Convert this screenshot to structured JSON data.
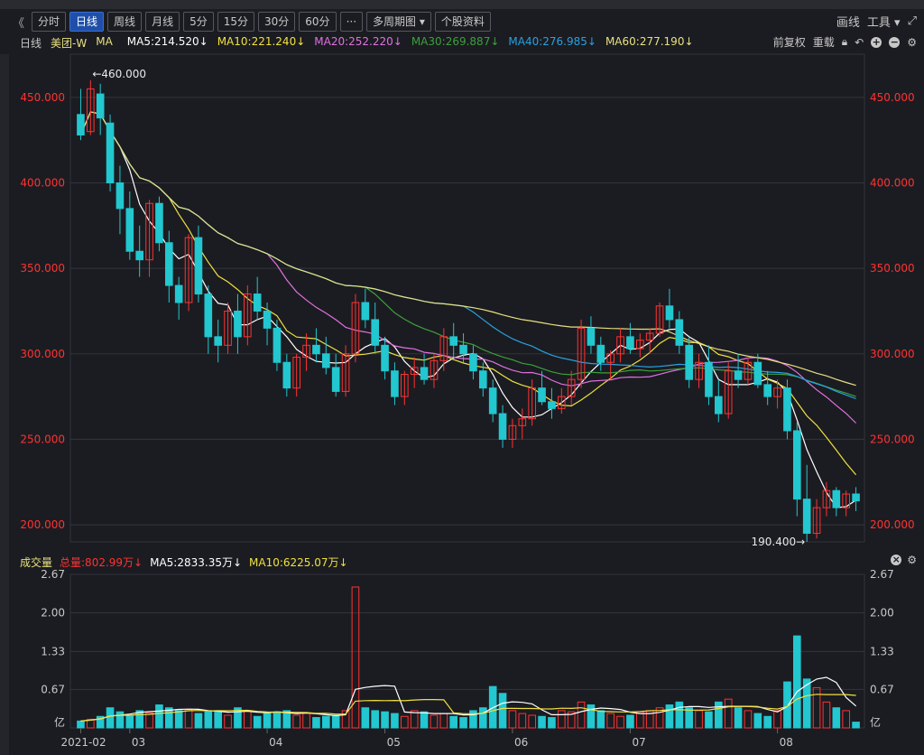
{
  "toolbar": {
    "nav_prev": "《",
    "buttons": [
      "分时",
      "日线",
      "周线",
      "月线",
      "5分",
      "15分",
      "30分",
      "60分",
      "···",
      "多周期图 ▾",
      "个股资料"
    ],
    "active_index": 1,
    "draw_label": "画线",
    "tools_label": "工具 ▾",
    "expand_icon": "expand-icon"
  },
  "ma_legend": {
    "period": "日线",
    "name": "美团-W",
    "ma": "MA",
    "items": [
      {
        "label": "MA5:214.520↓",
        "color": "#ffffff"
      },
      {
        "label": "MA10:221.240↓",
        "color": "#f0e040"
      },
      {
        "label": "MA20:252.220↓",
        "color": "#e070e0"
      },
      {
        "label": "MA30:269.887↓",
        "color": "#3ca03c"
      },
      {
        "label": "MA40:276.985↓",
        "color": "#2aa0e0"
      },
      {
        "label": "MA60:277.190↓",
        "color": "#e8e080"
      }
    ],
    "adjust": "前复权",
    "reload": "重载"
  },
  "price_axis": {
    "ticks": [
      "450.000",
      "400.000",
      "350.000",
      "300.000",
      "250.000",
      "200.000"
    ],
    "high_label": "←460.000",
    "low_label": "190.400→"
  },
  "volume_panel": {
    "title": "成交量",
    "total": "总量:802.99万↓",
    "ma5": "MA5:2833.35万↓",
    "ma10": "MA10:6225.07万↓",
    "ticks": [
      "2.67",
      "2.00",
      "1.33",
      "0.67",
      "亿"
    ]
  },
  "x_axis": {
    "labels": [
      "2021-02",
      "03",
      "04",
      "05",
      "06",
      "07",
      "08"
    ]
  },
  "colors": {
    "up": "#ff3232",
    "down": "#22c7d0",
    "bg": "#1b1c21",
    "grid": "#33353c"
  },
  "chart_data": {
    "type": "candlestick",
    "title": "",
    "ylim": [
      190,
      470
    ],
    "ohlc": [
      [
        440,
        455,
        425,
        428
      ],
      [
        430,
        460,
        428,
        455
      ],
      [
        452,
        458,
        428,
        438
      ],
      [
        435,
        440,
        395,
        400
      ],
      [
        400,
        410,
        370,
        385
      ],
      [
        385,
        395,
        355,
        360
      ],
      [
        360,
        375,
        345,
        355
      ],
      [
        355,
        390,
        345,
        388
      ],
      [
        388,
        392,
        360,
        365
      ],
      [
        365,
        372,
        330,
        340
      ],
      [
        340,
        345,
        320,
        330
      ],
      [
        330,
        370,
        325,
        368
      ],
      [
        368,
        375,
        330,
        335
      ],
      [
        335,
        340,
        300,
        310
      ],
      [
        310,
        320,
        295,
        305
      ],
      [
        305,
        330,
        300,
        325
      ],
      [
        325,
        335,
        300,
        310
      ],
      [
        310,
        340,
        305,
        335
      ],
      [
        335,
        345,
        320,
        325
      ],
      [
        325,
        330,
        305,
        315
      ],
      [
        315,
        320,
        290,
        295
      ],
      [
        295,
        300,
        275,
        280
      ],
      [
        280,
        300,
        275,
        298
      ],
      [
        298,
        312,
        290,
        305
      ],
      [
        305,
        315,
        295,
        300
      ],
      [
        300,
        310,
        288,
        292
      ],
      [
        292,
        300,
        275,
        278
      ],
      [
        278,
        305,
        275,
        300
      ],
      [
        300,
        335,
        295,
        330
      ],
      [
        330,
        338,
        315,
        320
      ],
      [
        320,
        330,
        300,
        305
      ],
      [
        305,
        310,
        285,
        290
      ],
      [
        290,
        295,
        270,
        275
      ],
      [
        275,
        290,
        270,
        288
      ],
      [
        288,
        298,
        280,
        292
      ],
      [
        292,
        300,
        282,
        285
      ],
      [
        285,
        300,
        280,
        296
      ],
      [
        296,
        315,
        290,
        310
      ],
      [
        310,
        318,
        298,
        305
      ],
      [
        305,
        312,
        295,
        300
      ],
      [
        300,
        305,
        285,
        290
      ],
      [
        290,
        295,
        275,
        280
      ],
      [
        280,
        285,
        260,
        265
      ],
      [
        265,
        270,
        245,
        250
      ],
      [
        250,
        262,
        245,
        258
      ],
      [
        258,
        268,
        250,
        262
      ],
      [
        262,
        285,
        258,
        280
      ],
      [
        280,
        290,
        270,
        272
      ],
      [
        272,
        280,
        262,
        268
      ],
      [
        268,
        280,
        265,
        275
      ],
      [
        275,
        290,
        270,
        285
      ],
      [
        285,
        320,
        280,
        315
      ],
      [
        315,
        322,
        300,
        305
      ],
      [
        305,
        310,
        290,
        295
      ],
      [
        295,
        302,
        285,
        300
      ],
      [
        300,
        315,
        295,
        310
      ],
      [
        310,
        318,
        300,
        303
      ],
      [
        303,
        312,
        298,
        308
      ],
      [
        308,
        315,
        300,
        312
      ],
      [
        312,
        330,
        310,
        328
      ],
      [
        328,
        338,
        315,
        320
      ],
      [
        320,
        325,
        300,
        305
      ],
      [
        305,
        310,
        280,
        285
      ],
      [
        285,
        300,
        280,
        295
      ],
      [
        295,
        305,
        270,
        275
      ],
      [
        275,
        285,
        260,
        265
      ],
      [
        265,
        295,
        262,
        290
      ],
      [
        290,
        300,
        280,
        285
      ],
      [
        285,
        298,
        282,
        295
      ],
      [
        295,
        300,
        280,
        282
      ],
      [
        282,
        290,
        270,
        275
      ],
      [
        275,
        285,
        268,
        280
      ],
      [
        280,
        285,
        250,
        255
      ],
      [
        255,
        260,
        205,
        215
      ],
      [
        215,
        235,
        190,
        195
      ],
      [
        195,
        215,
        192,
        210
      ],
      [
        210,
        225,
        205,
        220
      ],
      [
        220,
        222,
        205,
        210
      ],
      [
        210,
        220,
        205,
        218
      ],
      [
        218,
        222,
        208,
        214
      ]
    ],
    "volume_100m": [
      0.12,
      0.15,
      0.2,
      0.35,
      0.28,
      0.22,
      0.3,
      0.26,
      0.4,
      0.35,
      0.3,
      0.32,
      0.25,
      0.28,
      0.3,
      0.22,
      0.35,
      0.3,
      0.2,
      0.25,
      0.28,
      0.3,
      0.22,
      0.25,
      0.18,
      0.2,
      0.22,
      0.3,
      2.45,
      0.35,
      0.3,
      0.28,
      0.25,
      0.2,
      0.3,
      0.28,
      0.22,
      0.25,
      0.2,
      0.18,
      0.3,
      0.35,
      0.72,
      0.6,
      0.3,
      0.25,
      0.22,
      0.2,
      0.18,
      0.3,
      0.28,
      0.45,
      0.4,
      0.3,
      0.25,
      0.2,
      0.22,
      0.28,
      0.3,
      0.35,
      0.4,
      0.45,
      0.35,
      0.3,
      0.28,
      0.45,
      0.5,
      0.35,
      0.3,
      0.25,
      0.2,
      0.3,
      0.8,
      1.6,
      0.85,
      0.7,
      0.45,
      0.35,
      0.3,
      0.1
    ]
  }
}
